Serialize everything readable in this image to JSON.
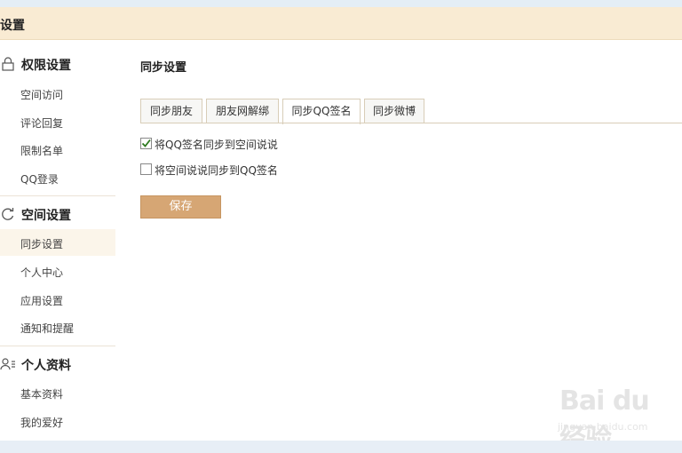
{
  "window": {
    "title": "设置"
  },
  "sidebar": {
    "groups": [
      {
        "icon": "lock-icon",
        "label": "权限设置",
        "items": [
          "空间访问",
          "评论回复",
          "限制名单",
          "QQ登录"
        ]
      },
      {
        "icon": "refresh-icon",
        "label": "空间设置",
        "items": [
          "同步设置",
          "个人中心",
          "应用设置",
          "通知和提醒"
        ]
      },
      {
        "icon": "profile-card-icon",
        "label": "个人资料",
        "items": [
          "基本资料",
          "我的爱好"
        ]
      }
    ],
    "active_item": "同步设置"
  },
  "main": {
    "title": "同步设置",
    "tabs": [
      "同步朋友",
      "朋友网解绑",
      "同步QQ签名",
      "同步微博"
    ],
    "active_tab": "同步QQ签名",
    "options": [
      {
        "label": "将QQ签名同步到空间说说",
        "checked": true
      },
      {
        "label": "将空间说说同步到QQ签名",
        "checked": false
      }
    ],
    "save_label": "保存"
  },
  "watermark": {
    "text": "Bai du 经验",
    "url": "jingyan.baidu.com"
  },
  "colors": {
    "titlebar": "#f9ebd3",
    "button": "#d6a674",
    "active_item_bg": "#fbf5ea"
  }
}
